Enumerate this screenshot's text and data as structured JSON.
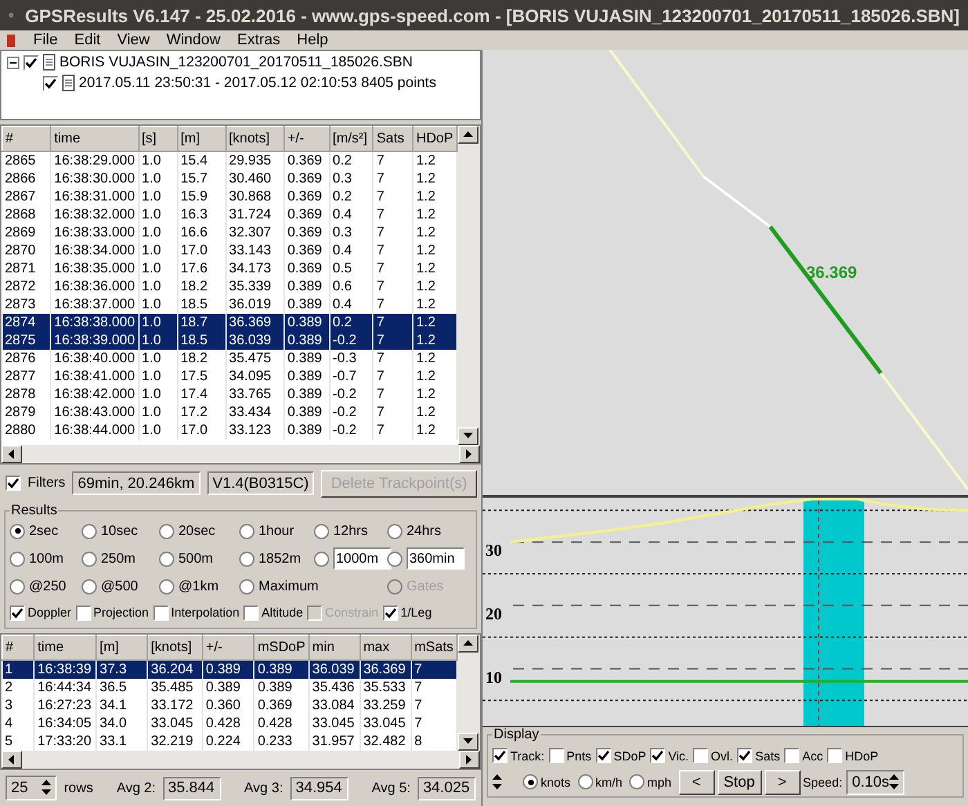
{
  "window": {
    "title": "GPSResults V6.147 - 25.02.2016 - www.gps-speed.com - [BORIS  VUJASIN_123200701_20170511_185026.SBN]"
  },
  "menu": [
    "File",
    "Edit",
    "View",
    "Window",
    "Extras",
    "Help"
  ],
  "tree": {
    "label": "BORIS  VUJASIN_123200701_20170511_185026.SBN",
    "checked": true,
    "expanded": true,
    "children": [
      {
        "label": "2017.05.11 23:50:31 - 2017.05.12 02:10:53  8405 points",
        "checked": true
      }
    ]
  },
  "track_table": {
    "columns": [
      "#",
      "time",
      "[s]",
      "[m]",
      "[knots]",
      "+/-",
      "[m/s²]",
      "Sats",
      "HDoP"
    ],
    "rows": [
      {
        "cells": [
          "2865",
          "16:38:29.000",
          "1.0",
          "15.4",
          "29.935",
          "0.369",
          "0.2",
          "7",
          "1.2"
        ],
        "selected": false
      },
      {
        "cells": [
          "2866",
          "16:38:30.000",
          "1.0",
          "15.7",
          "30.460",
          "0.369",
          "0.3",
          "7",
          "1.2"
        ],
        "selected": false
      },
      {
        "cells": [
          "2867",
          "16:38:31.000",
          "1.0",
          "15.9",
          "30.868",
          "0.369",
          "0.2",
          "7",
          "1.2"
        ],
        "selected": false
      },
      {
        "cells": [
          "2868",
          "16:38:32.000",
          "1.0",
          "16.3",
          "31.724",
          "0.369",
          "0.4",
          "7",
          "1.2"
        ],
        "selected": false
      },
      {
        "cells": [
          "2869",
          "16:38:33.000",
          "1.0",
          "16.6",
          "32.307",
          "0.369",
          "0.3",
          "7",
          "1.2"
        ],
        "selected": false
      },
      {
        "cells": [
          "2870",
          "16:38:34.000",
          "1.0",
          "17.0",
          "33.143",
          "0.369",
          "0.4",
          "7",
          "1.2"
        ],
        "selected": false
      },
      {
        "cells": [
          "2871",
          "16:38:35.000",
          "1.0",
          "17.6",
          "34.173",
          "0.369",
          "0.5",
          "7",
          "1.2"
        ],
        "selected": false
      },
      {
        "cells": [
          "2872",
          "16:38:36.000",
          "1.0",
          "18.2",
          "35.339",
          "0.389",
          "0.6",
          "7",
          "1.2"
        ],
        "selected": false
      },
      {
        "cells": [
          "2873",
          "16:38:37.000",
          "1.0",
          "18.5",
          "36.019",
          "0.389",
          "0.4",
          "7",
          "1.2"
        ],
        "selected": false
      },
      {
        "cells": [
          "2874",
          "16:38:38.000",
          "1.0",
          "18.7",
          "36.369",
          "0.389",
          "0.2",
          "7",
          "1.2"
        ],
        "selected": true
      },
      {
        "cells": [
          "2875",
          "16:38:39.000",
          "1.0",
          "18.5",
          "36.039",
          "0.389",
          "-0.2",
          "7",
          "1.2"
        ],
        "selected": true
      },
      {
        "cells": [
          "2876",
          "16:38:40.000",
          "1.0",
          "18.2",
          "35.475",
          "0.389",
          "-0.3",
          "7",
          "1.2"
        ],
        "selected": false
      },
      {
        "cells": [
          "2877",
          "16:38:41.000",
          "1.0",
          "17.5",
          "34.095",
          "0.389",
          "-0.7",
          "7",
          "1.2"
        ],
        "selected": false
      },
      {
        "cells": [
          "2878",
          "16:38:42.000",
          "1.0",
          "17.4",
          "33.765",
          "0.389",
          "-0.2",
          "7",
          "1.2"
        ],
        "selected": false
      },
      {
        "cells": [
          "2879",
          "16:38:43.000",
          "1.0",
          "17.2",
          "33.434",
          "0.389",
          "-0.2",
          "7",
          "1.2"
        ],
        "selected": false
      },
      {
        "cells": [
          "2880",
          "16:38:44.000",
          "1.0",
          "17.0",
          "33.123",
          "0.389",
          "-0.2",
          "7",
          "1.2"
        ],
        "selected": false
      }
    ]
  },
  "filters": {
    "label": "Filters",
    "checked": true,
    "fields": [
      "69min, 20.246km",
      "V1.4(B0315C)"
    ],
    "delete_button": {
      "label": "Delete Trackpoint(s)",
      "disabled": true
    }
  },
  "results": {
    "title": "Results",
    "options": [
      [
        {
          "label": "2sec",
          "selected": true,
          "kind": "radio"
        },
        {
          "label": "10sec",
          "selected": false,
          "kind": "radio"
        },
        {
          "label": "20sec",
          "selected": false,
          "kind": "radio"
        },
        {
          "label": "1hour",
          "selected": false,
          "kind": "radio"
        },
        {
          "label": "12hrs",
          "selected": false,
          "kind": "radio"
        },
        {
          "label": "24hrs",
          "selected": false,
          "kind": "radio"
        }
      ],
      [
        {
          "label": "100m",
          "selected": false,
          "kind": "radio"
        },
        {
          "label": "250m",
          "selected": false,
          "kind": "radio"
        },
        {
          "label": "500m",
          "selected": false,
          "kind": "radio"
        },
        {
          "label": "1852m",
          "selected": false,
          "kind": "radio"
        },
        {
          "value": "1000m",
          "selected": false,
          "kind": "field"
        },
        {
          "value": "360min",
          "selected": false,
          "kind": "field"
        }
      ],
      [
        {
          "label": "@250",
          "selected": false,
          "kind": "radio"
        },
        {
          "label": "@500",
          "selected": false,
          "kind": "radio"
        },
        {
          "label": "@1km",
          "selected": false,
          "kind": "radio"
        },
        {
          "label": "Maximum",
          "selected": false,
          "kind": "radio"
        },
        {
          "label": "Gates",
          "selected": false,
          "kind": "radio",
          "disabled": true
        }
      ]
    ],
    "checks": [
      {
        "label": "Doppler",
        "checked": true,
        "disabled": false
      },
      {
        "label": "Projection",
        "checked": false,
        "disabled": false
      },
      {
        "label": "Interpolation",
        "checked": false,
        "disabled": false
      },
      {
        "label": "Altitude",
        "checked": false,
        "disabled": false
      },
      {
        "label": "Constrain",
        "checked": false,
        "disabled": true
      },
      {
        "label": "1/Leg",
        "checked": true,
        "disabled": false
      }
    ]
  },
  "results_table": {
    "columns": [
      "#",
      "time",
      "[m]",
      "[knots]",
      "+/-",
      "mSDoP",
      "min",
      "max",
      "mSats"
    ],
    "rows": [
      {
        "cells": [
          "1",
          "16:38:39",
          "37.3",
          "36.204",
          "0.389",
          "0.389",
          "36.039",
          "36.369",
          "7"
        ],
        "selected": true
      },
      {
        "cells": [
          "2",
          "16:44:34",
          "36.5",
          "35.485",
          "0.389",
          "0.389",
          "35.436",
          "35.533",
          "7"
        ],
        "selected": false
      },
      {
        "cells": [
          "3",
          "16:27:23",
          "34.1",
          "33.172",
          "0.360",
          "0.369",
          "33.084",
          "33.259",
          "7"
        ],
        "selected": false
      },
      {
        "cells": [
          "4",
          "16:34:05",
          "34.0",
          "33.045",
          "0.428",
          "0.428",
          "33.045",
          "33.045",
          "7"
        ],
        "selected": false
      },
      {
        "cells": [
          "5",
          "17:33:20",
          "33.1",
          "32.219",
          "0.224",
          "0.233",
          "31.957",
          "32.482",
          "8"
        ],
        "selected": false
      }
    ]
  },
  "footer": {
    "rows_value": "25",
    "rows_label": "rows",
    "averages": [
      {
        "label": "Avg 2:",
        "value": "35.844"
      },
      {
        "label": "Avg 3:",
        "value": "34.954"
      },
      {
        "label": "Avg 5:",
        "value": "34.025"
      }
    ]
  },
  "map": {
    "segment_label": "36.369"
  },
  "speed_chart": {
    "axis_labels": [
      "30",
      "20",
      "10"
    ]
  },
  "display": {
    "title": "Display",
    "checks": [
      {
        "label": "Track:",
        "checked": true
      },
      {
        "label": "Pnts",
        "checked": false
      },
      {
        "label": "SDoP",
        "checked": true
      },
      {
        "label": "Vic.",
        "checked": true
      },
      {
        "label": "Ovl.",
        "checked": false
      },
      {
        "label": "Sats",
        "checked": true
      },
      {
        "label": "Acc",
        "checked": false
      },
      {
        "label": "HDoP",
        "checked": false
      }
    ],
    "units": [
      {
        "label": "knots",
        "selected": true
      },
      {
        "label": "km/h",
        "selected": false
      },
      {
        "label": "mph",
        "selected": false
      }
    ],
    "buttons": [
      "<",
      "Stop",
      ">"
    ],
    "speed_label": "Speed:",
    "speed_value": "0.10s"
  }
}
